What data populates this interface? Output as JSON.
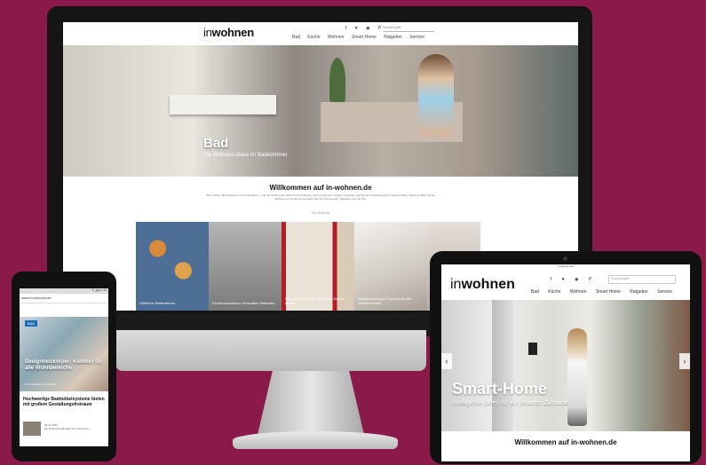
{
  "imac": {
    "logo_light": "in",
    "logo_bold": "wohnen",
    "social_icons": "f ♥ ◉ P",
    "search_placeholder": "Suchbegriff",
    "nav": [
      "Bad",
      "Küche",
      "Wohnen",
      "Smart Home",
      "Ratgeber",
      "Service"
    ],
    "hero_title": "Bad",
    "hero_subtitle": "Die Wellness-Oase im Badezimmer",
    "welcome_title": "Willkommen auf in-wohnen.de",
    "welcome_text": "Wir möchten Sie inspirieren und unterstützen – bei der Suche nach Ideen für Ihr Zuhause, beim Finden der richtigen Lösungen und bei der Umsetzung Ihrer eigenen Pläne. Rund um Bad, Küche, Wohnen und Smart Home finden Sie hier Anregungen, Ratgeber und Service.",
    "more_link": "Ein Auszug",
    "tiles": [
      {
        "caption": "Hilfreiche Badezimmer...",
        "color": "#4d6e95"
      },
      {
        "caption": "Küchenarmaturen: Innovative Varianten",
        "color": "#8e8e8e"
      },
      {
        "caption": "Fun-Bad für Kinder: Mit einem Design kreativ",
        "color": "#c7b59b"
      },
      {
        "caption": "Designheizkörper: Komfort für alle Wohnbereiche",
        "color": "#d5d1cb"
      },
      {
        "caption": "",
        "color": "#c9c0b8"
      }
    ]
  },
  "phone": {
    "status": "▼ ◢ ▮ 12:30",
    "url": "www.in-wohnen.de",
    "tag": "BAD",
    "hero_title": "Designheizkörper: Komfort für alle Wohnbereiche",
    "hero_sub": "zum Ratgeber des Monats",
    "article_title": "Hochwertige Badmöbelsysteme bieten mit großem Gestaltungsfreiraum",
    "article_meta": "28.02.2019",
    "article_desc": "Ein Badmöbel-Modell von Knebelung..."
  },
  "tablet": {
    "status": "in-wohnen.de",
    "logo_light": "in",
    "logo_bold": "wohnen",
    "social_icons": "f ♥ ◉ P",
    "search_placeholder": "Suchbegriff",
    "nav": [
      "Bad",
      "Küche",
      "Wohnen",
      "Smart Home",
      "Ratgeber",
      "Service"
    ],
    "hero_title": "Smart-Home",
    "hero_subtitle": "Intelligente Ideen für ein smartes Zuhause",
    "arrow_left": "‹",
    "arrow_right": "›",
    "welcome_title": "Willkommen auf in-wohnen.de"
  },
  "colors": {
    "background": "#8a1a4a",
    "bezel": "#151515",
    "accent": "#1d6ab0"
  }
}
